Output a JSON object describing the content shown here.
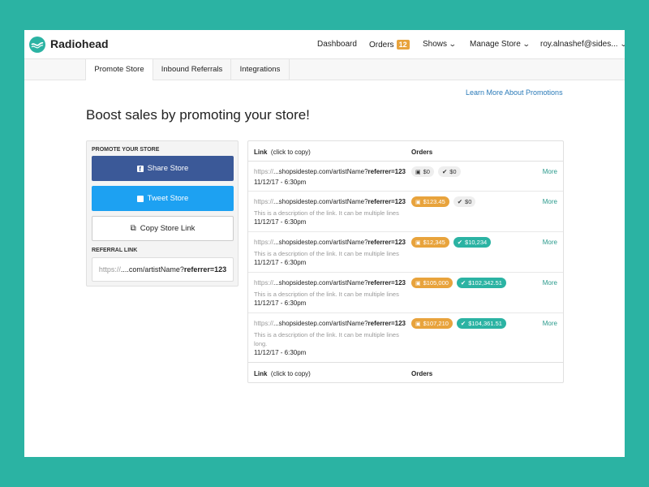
{
  "brand": "Radiohead",
  "nav": {
    "dashboard": "Dashboard",
    "orders": "Orders",
    "orders_count": "12",
    "shows": "Shows",
    "manage_store": "Manage Store",
    "user": "roy.alnashef@sides..."
  },
  "tabs": [
    "Promote Store",
    "Inbound Referrals",
    "Integrations"
  ],
  "learn_more": "Learn More About Promotions",
  "headline": "Boost sales by promoting your store!",
  "left": {
    "promote_label": "PROMOTE YOUR STORE",
    "share": "Share Store",
    "tweet": "Tweet Store",
    "copy": "Copy Store Link",
    "referral_label": "REFERRAL LINK",
    "ref_prefix": "https://",
    "ref_middle": "....com/artistName?",
    "ref_bold": "referrer=123"
  },
  "table": {
    "col_link": "Link",
    "col_link_hint": "(click to copy)",
    "col_orders": "Orders",
    "more": "More",
    "url_prefix": "https://",
    "url_middle": "...shopsidestep.com/artistName?",
    "url_bold": "referrer=123",
    "rows": [
      {
        "desc": "",
        "date": "11/12/17 - 6:30pm",
        "cart": "$0",
        "check": "$0",
        "cart_style": "grey",
        "check_style": "grey"
      },
      {
        "desc": "This is a description of the link. It can be multiple lines",
        "date": "11/12/17 - 6:30pm",
        "cart": "$123.45",
        "check": "$0",
        "cart_style": "orange",
        "check_style": "grey"
      },
      {
        "desc": "This is a description of the link. It can be multiple lines",
        "date": "11/12/17 - 6:30pm",
        "cart": "$12,345",
        "check": "$10,234",
        "cart_style": "orange",
        "check_style": "teal"
      },
      {
        "desc": "This is a description of the link. It can be multiple lines",
        "date": "11/12/17 - 6:30pm",
        "cart": "$105,000",
        "check": "$102,342.51",
        "cart_style": "orange",
        "check_style": "teal"
      },
      {
        "desc": "This is a description of the link. It can be multiple lines long.",
        "date": "11/12/17 - 6:30pm",
        "cart": "$107,210",
        "check": "$104,361.51",
        "cart_style": "orange",
        "check_style": "teal"
      }
    ]
  },
  "colors": {
    "accent": "#2bb3a3",
    "facebook": "#3b5998",
    "twitter": "#1da1f2",
    "orange": "#e8a33c",
    "link": "#2a7ab8"
  }
}
